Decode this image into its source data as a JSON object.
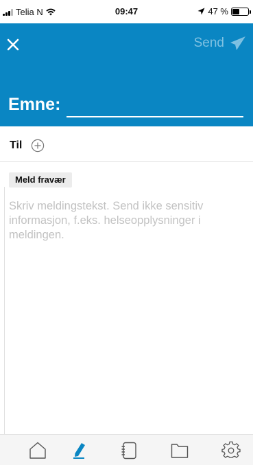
{
  "status_bar": {
    "carrier": "Telia N",
    "time": "09:47",
    "battery_percent": "47 %",
    "battery_level": 0.47
  },
  "header": {
    "close_icon": "close-icon",
    "send_label": "Send",
    "send_icon": "paper-plane-icon",
    "subject_label": "Emne:",
    "subject_value": "",
    "background_color": "#0a86c3"
  },
  "recipients": {
    "label": "Til",
    "add_icon": "plus-circle-icon"
  },
  "tag": {
    "label": "Meld fravær"
  },
  "message": {
    "placeholder": "Skriv meldingstekst. Send ikke sensitiv informasjon, f.eks. helseopplysninger i meldingen."
  },
  "tabbar": {
    "items": [
      {
        "icon": "home-icon",
        "active": false
      },
      {
        "icon": "compose-icon",
        "active": true
      },
      {
        "icon": "notebook-icon",
        "active": false
      },
      {
        "icon": "folder-icon",
        "active": false
      },
      {
        "icon": "gear-icon",
        "active": false
      }
    ],
    "active_color": "#0a86c3"
  }
}
